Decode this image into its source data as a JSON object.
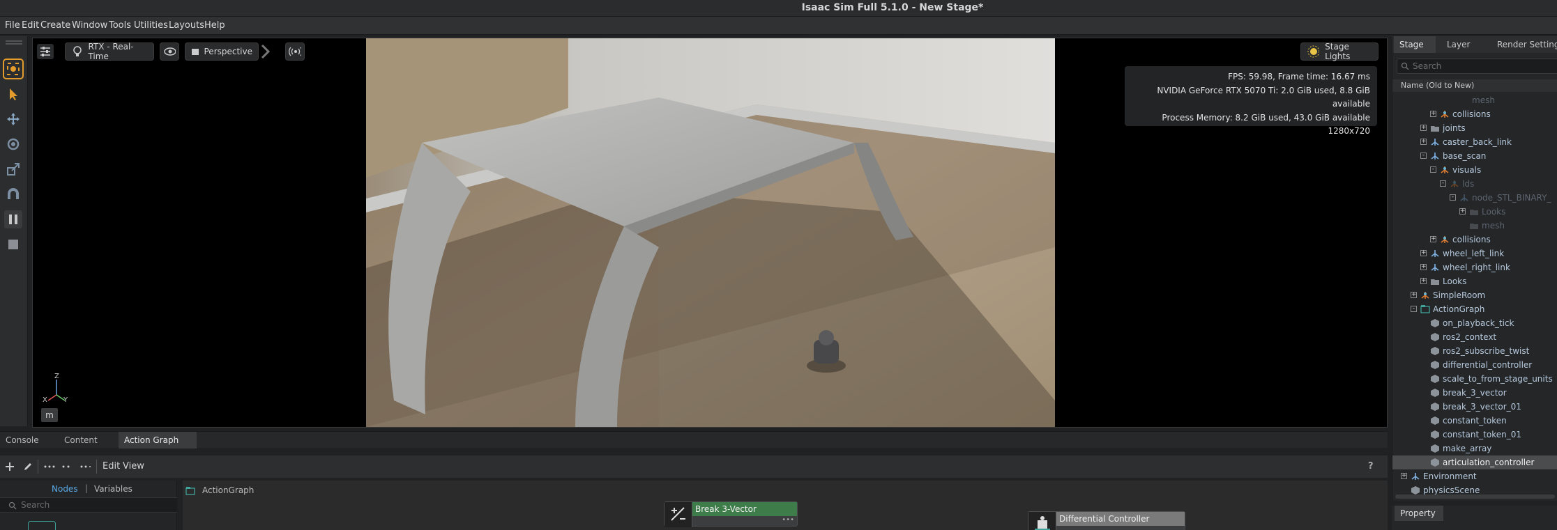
{
  "window": {
    "title": "Isaac Sim Full 5.1.0 - New Stage*"
  },
  "menu": [
    "File",
    "Edit",
    "Create",
    "Window",
    "Tools",
    "Utilities",
    "Layouts",
    "Help"
  ],
  "viewport": {
    "renderer": "RTX - Real-Time",
    "camera": "Perspective",
    "lights": "Stage Lights",
    "stats": {
      "fps": "FPS: 59.98, Frame time: 16.67 ms",
      "gpu": "NVIDIA GeForce RTX 5070 Ti: 2.0 GiB used, 8.8 GiB available",
      "mem": "Process Memory: 8.2 GiB used, 43.0 GiB available",
      "res": "1280x720"
    },
    "axis_labels": {
      "z": "Z",
      "x": "X",
      "y": "Y"
    },
    "units_button": "m"
  },
  "stage": {
    "tabs": [
      "Stage",
      "Layer",
      "Render Settings"
    ],
    "search_placeholder": "Search",
    "column": "Name (Old to New)",
    "tree": [
      {
        "label": "mesh",
        "indent": 6,
        "dim": true,
        "exp": "",
        "icon": "none"
      },
      {
        "label": "collisions",
        "indent": 4,
        "dim": false,
        "exp": "+",
        "icon": "xform-multi"
      },
      {
        "label": "joints",
        "indent": 3,
        "dim": false,
        "exp": "+",
        "icon": "folder"
      },
      {
        "label": "caster_back_link",
        "indent": 3,
        "dim": false,
        "exp": "+",
        "icon": "xform"
      },
      {
        "label": "base_scan",
        "indent": 3,
        "dim": false,
        "exp": "-",
        "icon": "xform"
      },
      {
        "label": "visuals",
        "indent": 4,
        "dim": false,
        "exp": "-",
        "icon": "xform-multi"
      },
      {
        "label": "lds",
        "indent": 5,
        "dim": true,
        "exp": "-",
        "icon": "xform-multi"
      },
      {
        "label": "node_STL_BINARY_",
        "indent": 6,
        "dim": true,
        "exp": "-",
        "icon": "xform"
      },
      {
        "label": "Looks",
        "indent": 7,
        "dim": true,
        "exp": "+",
        "icon": "folder"
      },
      {
        "label": "mesh",
        "indent": 7,
        "dim": true,
        "exp": "",
        "icon": "folder"
      },
      {
        "label": "collisions",
        "indent": 4,
        "dim": false,
        "exp": "+",
        "icon": "xform-multi"
      },
      {
        "label": "wheel_left_link",
        "indent": 3,
        "dim": false,
        "exp": "+",
        "icon": "xform"
      },
      {
        "label": "wheel_right_link",
        "indent": 3,
        "dim": false,
        "exp": "+",
        "icon": "xform"
      },
      {
        "label": "Looks",
        "indent": 3,
        "dim": false,
        "exp": "+",
        "icon": "folder"
      },
      {
        "label": "SimpleRoom",
        "indent": 2,
        "dim": false,
        "exp": "+",
        "icon": "xform-multi"
      },
      {
        "label": "ActionGraph",
        "indent": 2,
        "dim": false,
        "exp": "-",
        "icon": "graph"
      },
      {
        "label": "on_playback_tick",
        "indent": 3,
        "dim": false,
        "exp": "",
        "icon": "node"
      },
      {
        "label": "ros2_context",
        "indent": 3,
        "dim": false,
        "exp": "",
        "icon": "node"
      },
      {
        "label": "ros2_subscribe_twist",
        "indent": 3,
        "dim": false,
        "exp": "",
        "icon": "node"
      },
      {
        "label": "differential_controller",
        "indent": 3,
        "dim": false,
        "exp": "",
        "icon": "node"
      },
      {
        "label": "scale_to_from_stage_units",
        "indent": 3,
        "dim": false,
        "exp": "",
        "icon": "node"
      },
      {
        "label": "break_3_vector",
        "indent": 3,
        "dim": false,
        "exp": "",
        "icon": "node"
      },
      {
        "label": "break_3_vector_01",
        "indent": 3,
        "dim": false,
        "exp": "",
        "icon": "node"
      },
      {
        "label": "constant_token",
        "indent": 3,
        "dim": false,
        "exp": "",
        "icon": "node"
      },
      {
        "label": "constant_token_01",
        "indent": 3,
        "dim": false,
        "exp": "",
        "icon": "node"
      },
      {
        "label": "make_array",
        "indent": 3,
        "dim": false,
        "exp": "",
        "icon": "node"
      },
      {
        "label": "articulation_controller",
        "indent": 3,
        "dim": false,
        "exp": "",
        "icon": "node",
        "selected": true
      },
      {
        "label": "Environment",
        "indent": 1,
        "dim": false,
        "exp": "+",
        "icon": "xform"
      },
      {
        "label": "physicsScene",
        "indent": 1,
        "dim": false,
        "exp": "",
        "icon": "node"
      }
    ],
    "property_tab": "Property"
  },
  "bottom": {
    "tabs": [
      "Console",
      "Content",
      "Action Graph"
    ],
    "toolbar": {
      "edit": "Edit",
      "view": "View",
      "help": "?"
    },
    "nodes_tab": "Nodes",
    "variables_tab": "Variables",
    "search_placeholder": "Search",
    "breadcrumb": "ActionGraph",
    "nodes": [
      {
        "title": "Break 3-Vector"
      },
      {
        "title": "Differential Controller"
      }
    ]
  }
}
